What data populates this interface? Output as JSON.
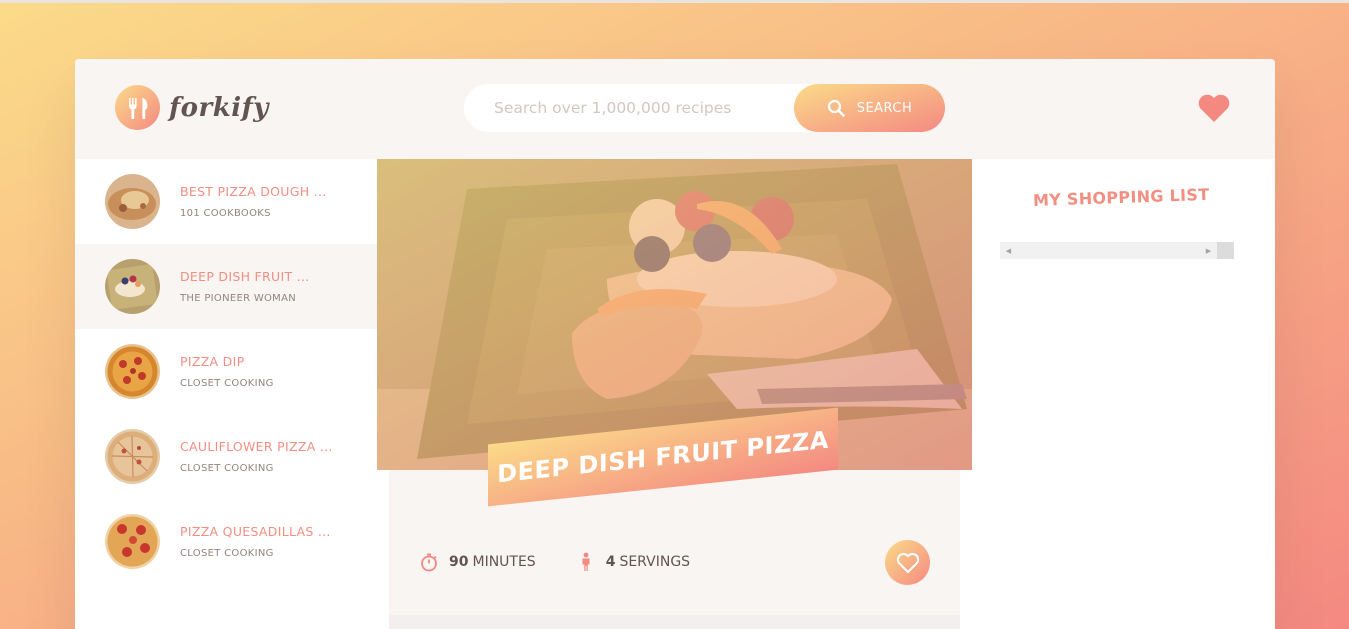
{
  "app": {
    "name": "forkify"
  },
  "search": {
    "placeholder": "Search over 1,000,000 recipes",
    "button_label": "SEARCH"
  },
  "results": [
    {
      "name": "BEST PIZZA DOUGH ...",
      "author": "101 COOKBOOKS",
      "active": false
    },
    {
      "name": "DEEP DISH FRUIT ...",
      "author": "THE PIONEER WOMAN",
      "active": true
    },
    {
      "name": "PIZZA DIP",
      "author": "CLOSET COOKING",
      "active": false
    },
    {
      "name": "CAULIFLOWER PIZZA ...",
      "author": "CLOSET COOKING",
      "active": false
    },
    {
      "name": "PIZZA QUESADILLAS ...",
      "author": "CLOSET COOKING",
      "active": false
    }
  ],
  "recipe": {
    "title": "DEEP DISH FRUIT PIZZA",
    "time_value": "90",
    "time_unit": "MINUTES",
    "servings_value": "4",
    "servings_unit": "SERVINGS"
  },
  "shopping": {
    "title": "MY SHOPPING LIST"
  },
  "colors": {
    "accent_start": "#fbdb89",
    "accent_end": "#f48982",
    "primary_text": "#f38e82",
    "body_text": "#615551",
    "panel_bg": "#f9f5f3"
  },
  "icons": {
    "logo": "fork-knife-icon",
    "search": "search-icon",
    "likes": "heart-icon",
    "time": "stopwatch-icon",
    "servings": "person-icon",
    "like_recipe": "heart-outline-icon"
  }
}
